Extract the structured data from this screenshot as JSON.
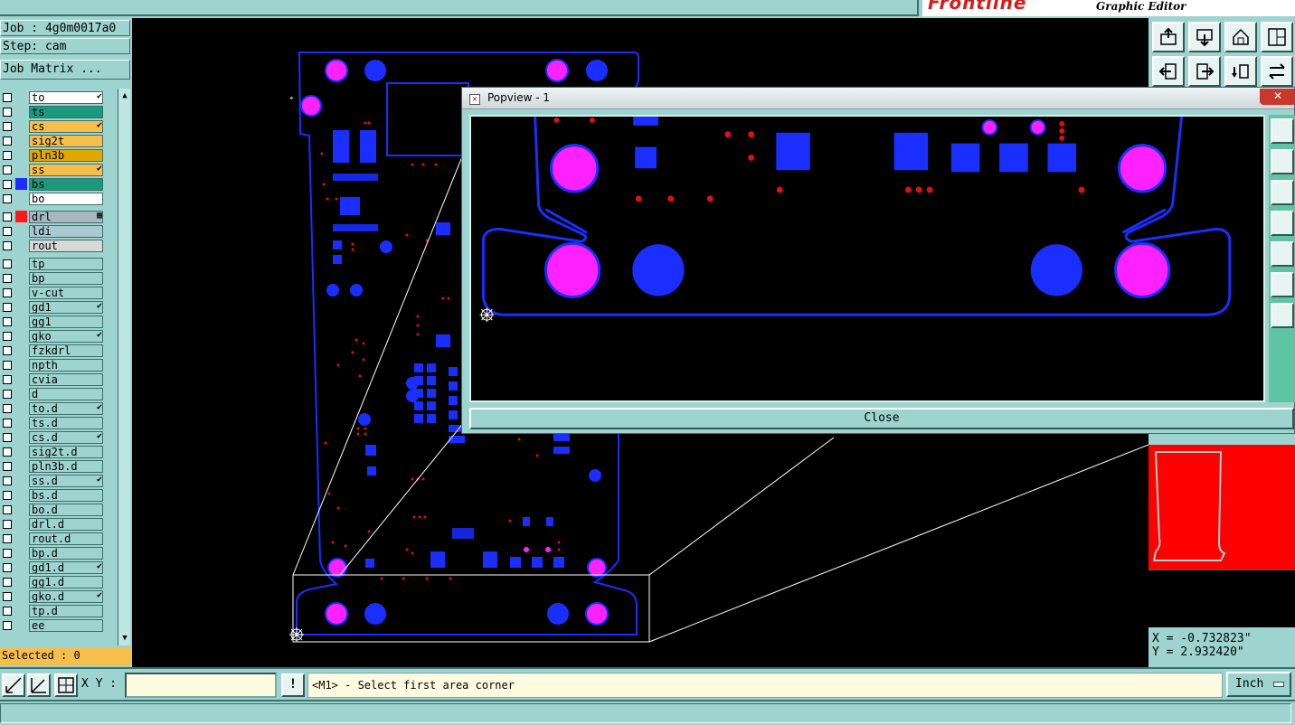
{
  "brand": {
    "logo": "Frontline",
    "subtitle": "Graphic Editor"
  },
  "job_info": {
    "job": "Job : 4g0m0017a0",
    "step": "Step: cam",
    "job_matrix": "Job Matrix ..."
  },
  "layers": [
    {
      "name": "to",
      "color": "#ffffff",
      "mark": "✔"
    },
    {
      "name": "ts",
      "color": "#1a9a7c",
      "mark": ""
    },
    {
      "name": "cs",
      "color": "#f6be4a",
      "mark": "✔"
    },
    {
      "name": "sig2t",
      "color": "#f6be4a",
      "mark": ""
    },
    {
      "name": "pln3b",
      "color": "#e0a800",
      "mark": ""
    },
    {
      "name": "ss",
      "color": "#f6be4a",
      "mark": "✔"
    },
    {
      "name": "bs",
      "color": "#1a9a7c",
      "mark": "",
      "swatch": "#1a2eff"
    },
    {
      "name": "bo",
      "color": "#ffffff",
      "mark": ""
    },
    {
      "name": "drl",
      "color": "#a9b8c0",
      "mark": "▦",
      "swatch": "#ff1a1a"
    },
    {
      "name": "ldi",
      "color": "#a9c8d0",
      "mark": ""
    },
    {
      "name": "rout",
      "color": "#d8d8d8",
      "mark": ""
    },
    {
      "name": "tp",
      "color": "#9ed4d0",
      "mark": ""
    },
    {
      "name": "bp",
      "color": "#9ed4d0",
      "mark": ""
    },
    {
      "name": "v-cut",
      "color": "#9ed4d0",
      "mark": ""
    },
    {
      "name": "gd1",
      "color": "#9ed4d0",
      "mark": "✔"
    },
    {
      "name": "gg1",
      "color": "#9ed4d0",
      "mark": ""
    },
    {
      "name": "gko",
      "color": "#9ed4d0",
      "mark": "✔"
    },
    {
      "name": "fzkdrl",
      "color": "#9ed4d0",
      "mark": ""
    },
    {
      "name": "npth",
      "color": "#9ed4d0",
      "mark": ""
    },
    {
      "name": "cvia",
      "color": "#9ed4d0",
      "mark": ""
    },
    {
      "name": "d",
      "color": "#9ed4d0",
      "mark": ""
    },
    {
      "name": "to.d",
      "color": "#9ed4d0",
      "mark": "✔"
    },
    {
      "name": "ts.d",
      "color": "#9ed4d0",
      "mark": ""
    },
    {
      "name": "cs.d",
      "color": "#9ed4d0",
      "mark": "✔"
    },
    {
      "name": "sig2t.d",
      "color": "#9ed4d0",
      "mark": ""
    },
    {
      "name": "pln3b.d",
      "color": "#9ed4d0",
      "mark": ""
    },
    {
      "name": "ss.d",
      "color": "#9ed4d0",
      "mark": "✔"
    },
    {
      "name": "bs.d",
      "color": "#9ed4d0",
      "mark": ""
    },
    {
      "name": "bo.d",
      "color": "#9ed4d0",
      "mark": ""
    },
    {
      "name": "drl.d",
      "color": "#9ed4d0",
      "mark": ""
    },
    {
      "name": "rout.d",
      "color": "#9ed4d0",
      "mark": ""
    },
    {
      "name": "bp.d",
      "color": "#9ed4d0",
      "mark": ""
    },
    {
      "name": "gd1.d",
      "color": "#9ed4d0",
      "mark": "✔"
    },
    {
      "name": "gg1.d",
      "color": "#9ed4d0",
      "mark": ""
    },
    {
      "name": "gko.d",
      "color": "#9ed4d0",
      "mark": "✔"
    },
    {
      "name": "tp.d",
      "color": "#9ed4d0",
      "mark": ""
    },
    {
      "name": "ee",
      "color": "#9ed4d0",
      "mark": ""
    }
  ],
  "selected": "Selected : 0",
  "popview": {
    "title": "Popview - 1",
    "close_x": "✕",
    "close_button": "Close"
  },
  "coordinates": {
    "x": "X = -0.732823\"",
    "y": "Y = 2.932420\""
  },
  "bottom": {
    "xy_label": "X Y :",
    "xy_value": "",
    "message": "<M1> - Select first area corner",
    "units": "Inch"
  },
  "colors": {
    "panel": "#9ed4d0",
    "pcb_outline": "#1a2eff",
    "pad_blue": "#1a2eff",
    "pad_magenta": "#ff22ff",
    "drill_red": "#e01010",
    "selected_bar": "#f6be4a",
    "minimap": "#ff0000"
  }
}
